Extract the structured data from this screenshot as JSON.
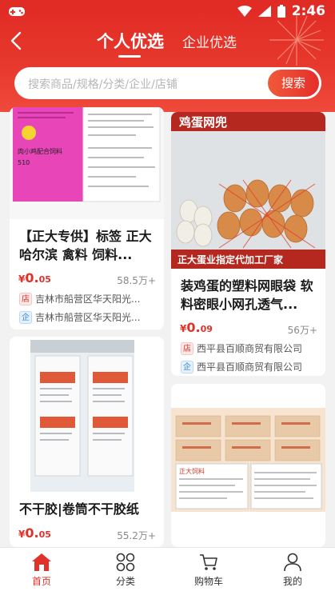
{
  "status": {
    "time": "2:46"
  },
  "nav": {
    "tab_personal": "个人优选",
    "tab_company": "企业优选"
  },
  "search": {
    "placeholder": "搜索商品/规格/分类/企业/店铺",
    "button": "搜索"
  },
  "products": [
    {
      "title": "【正大专供】标签 正大哈尔滨 禽料 饲料...",
      "price_symbol": "¥",
      "price_int": "0.",
      "price_dec": "05",
      "sales": "58.5万+",
      "shop": "吉林市船营区华天阳光...",
      "company": "吉林市船营区华天阳光...",
      "img_text": [
        "肉小鸡配合饲料",
        "510"
      ]
    },
    {
      "title": "装鸡蛋的塑料网眼袋 软料密眼小网孔透气...",
      "price_symbol": "¥",
      "price_int": "0.",
      "price_dec": "09",
      "sales": "56万+",
      "shop": "西平县百顺商贸有限公司",
      "company": "西平县百顺商贸有限公司",
      "img_text": [
        "鸡蛋网兜",
        "正大蛋业指定代加工厂家"
      ]
    },
    {
      "title": "不干胶|卷筒不干胶纸",
      "price_symbol": "¥",
      "price_int": "0.",
      "price_dec": "05",
      "sales": "55.2万+"
    },
    {
      "title": "",
      "img_text": [
        "正大饲料"
      ]
    }
  ],
  "shop_badge": "店",
  "company_badge": "企",
  "bottom_nav": [
    {
      "label": "首页",
      "icon": "home-icon",
      "active": true
    },
    {
      "label": "分类",
      "icon": "category-icon"
    },
    {
      "label": "购物车",
      "icon": "cart-icon"
    },
    {
      "label": "我的",
      "icon": "user-icon"
    }
  ],
  "colors": {
    "brand_red": "#e0322a",
    "header_red": "#e33228",
    "enterprise_blue": "#2f83e0"
  }
}
